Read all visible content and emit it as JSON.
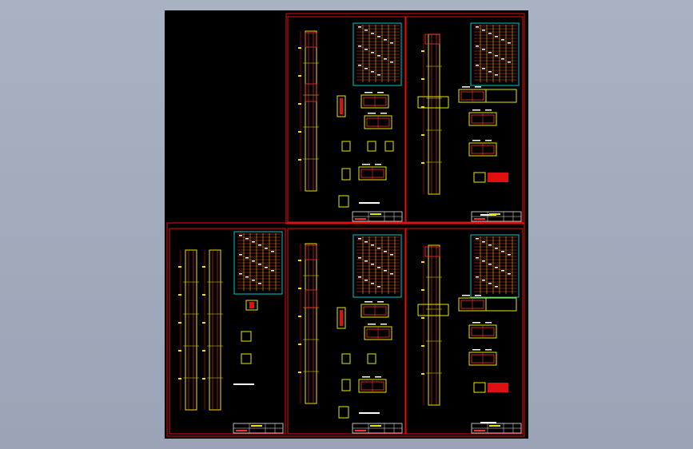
{
  "app": {
    "title": "",
    "background_color": "#a9b2c2",
    "canvas_color": "#000000"
  },
  "colors": {
    "frame": "#e01010",
    "column": "#e8e800",
    "table": "#00c8c8",
    "rebar": "#ff3030",
    "text": "#ffffff"
  },
  "sheets": [
    {
      "name": "sheet-top-middle"
    },
    {
      "name": "sheet-top-right"
    },
    {
      "name": "sheet-bottom-left"
    },
    {
      "name": "sheet-bottom-middle"
    },
    {
      "name": "sheet-bottom-right"
    }
  ]
}
